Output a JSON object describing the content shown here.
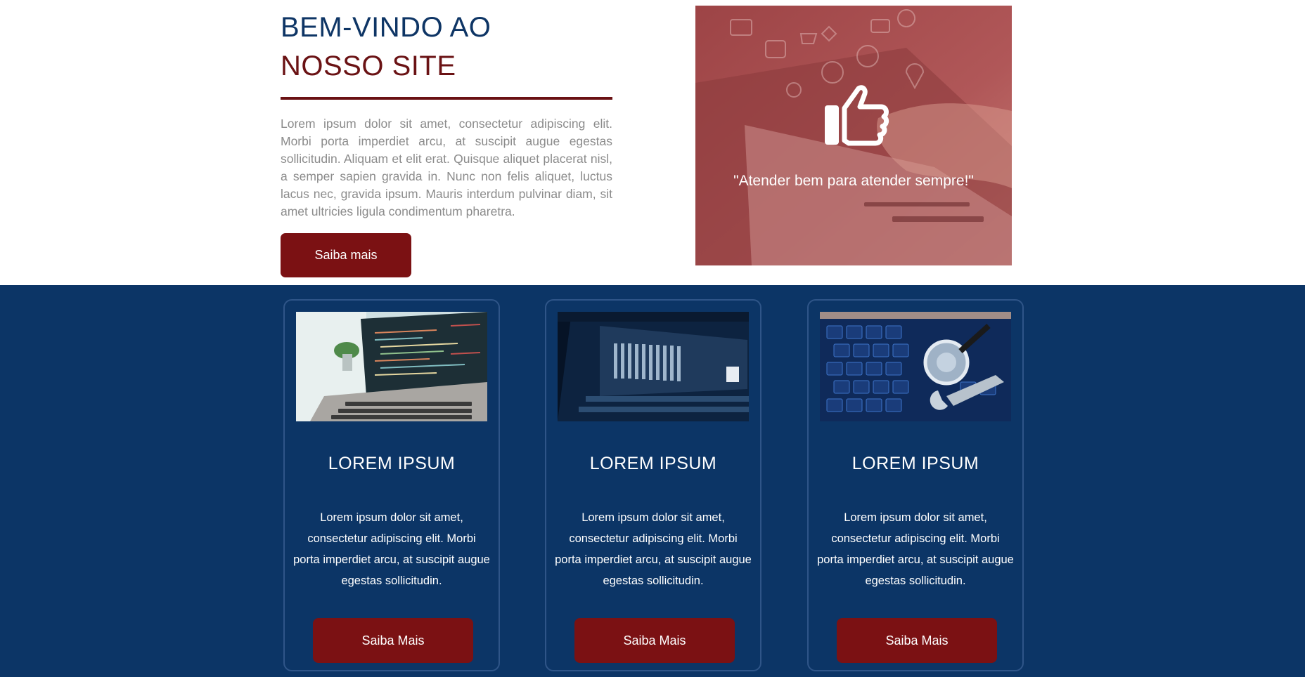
{
  "hero": {
    "title_line1": "BEM-VINDO AO",
    "title_line2": "NOSSO SITE",
    "paragraph": "Lorem ipsum dolor sit amet, consectetur adipiscing elit. Morbi porta imperdiet arcu, at suscipit augue egestas sollicitudin. Aliquam et elit erat. Quisque aliquet placerat nisl, a semper sapien gravida in. Nunc non felis aliquet, luctus lacus nec, gravida ipsum. Mauris interdum pulvinar diam, sit amet ultricies ligula condimentum pharetra.",
    "button_label": "Saiba mais",
    "image": {
      "quote": "\"Atender bem para atender sempre!\"",
      "icon": "thumbs-up-icon"
    }
  },
  "services": {
    "cards": [
      {
        "image": "laptop-code-photo",
        "title": "LOREM IPSUM",
        "text": "Lorem ipsum dolor sit amet, consectetur adipiscing elit. Morbi porta imperdiet arcu, at suscipit augue egestas sollicitudin.",
        "button_label": "Saiba Mais"
      },
      {
        "image": "server-rack-photo",
        "title": "LOREM IPSUM",
        "text": "Lorem ipsum dolor sit amet, consectetur adipiscing elit. Morbi porta imperdiet arcu, at suscipit augue egestas sollicitudin.",
        "button_label": "Saiba Mais"
      },
      {
        "image": "keyboard-stethoscope-photo",
        "title": "LOREM IPSUM",
        "text": "Lorem ipsum dolor sit amet, consectetur adipiscing elit. Morbi porta imperdiet arcu, at suscipit augue egestas sollicitudin.",
        "button_label": "Saiba Mais"
      }
    ]
  },
  "colors": {
    "navy": "#0c3566",
    "maroon": "#7b1113",
    "text_gray": "#8b8b8b"
  }
}
